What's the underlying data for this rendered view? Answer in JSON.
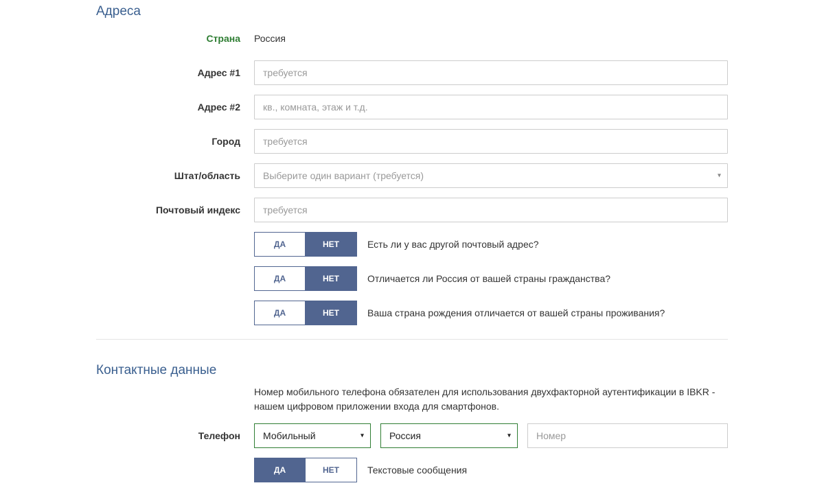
{
  "sections": {
    "address": {
      "title": "Адреса",
      "country_label": "Страна",
      "country_value": "Россия",
      "address1_label": "Адрес #1",
      "address1_placeholder": "требуется",
      "address2_label": "Адрес #2",
      "address2_placeholder": "кв., комната, этаж и т.д.",
      "city_label": "Город",
      "city_placeholder": "требуется",
      "state_label": "Штат/область",
      "state_placeholder": "Выберите один вариант (требуется)",
      "zip_label": "Почтовый индекс",
      "zip_placeholder": "требуется",
      "yes": "ДА",
      "no": "НЕТ",
      "q_other_mailing": "Есть ли у вас другой почтовый адрес?",
      "q_differs_citizenship": "Отличается ли Россия от вашей страны гражданства?",
      "q_birth_differs": "Ваша страна рождения отличается от вашей страны проживания?"
    },
    "contact": {
      "title": "Контактные данные",
      "help": "Номер мобильного телефона обязателен для использования двухфакторной аутентификации в IBKR - нашем цифровом приложении входа для смартфонов.",
      "phone_label": "Телефон",
      "phone_type": "Мобильный",
      "phone_country": "Россия",
      "phone_number_placeholder": "Номер",
      "yes": "ДА",
      "no": "НЕТ",
      "sms_label": "Текстовые сообщения"
    }
  }
}
